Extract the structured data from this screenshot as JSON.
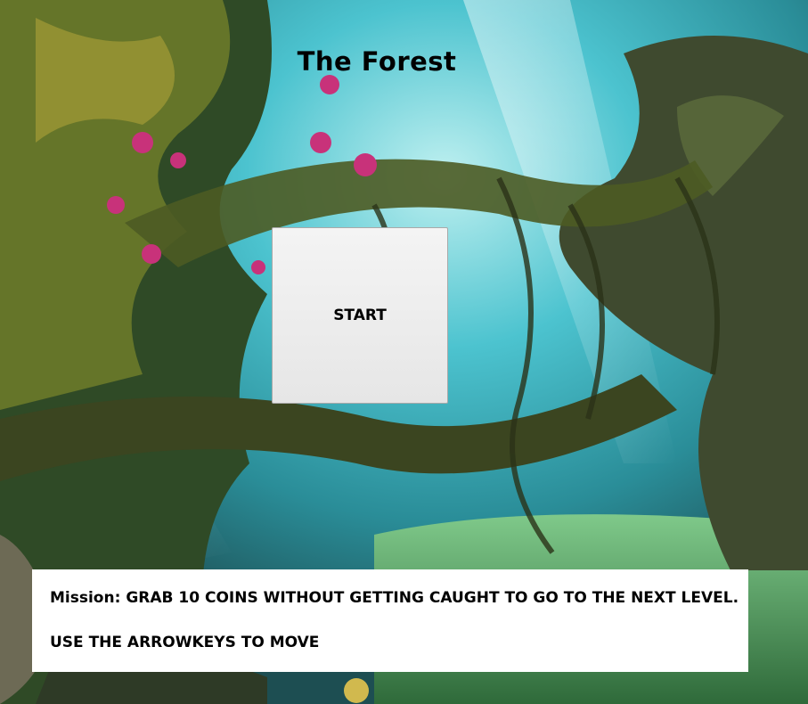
{
  "game": {
    "title": "The Forest"
  },
  "start_button": {
    "label": "START"
  },
  "instructions": {
    "mission_label": "Mission:",
    "mission_text": "GRAB 10 COINS WITHOUT GETTING CAUGHT TO GO TO THE NEXT LEVEL.",
    "controls_text": "USE THE ARROWKEYS TO MOVE"
  },
  "colors": {
    "sky": "#2bb4c7",
    "foliage": "#3f5f1f",
    "trunk": "#3a3f2a",
    "flower": "#c8327a",
    "panel": "#ffffff",
    "button": "#ededed"
  }
}
